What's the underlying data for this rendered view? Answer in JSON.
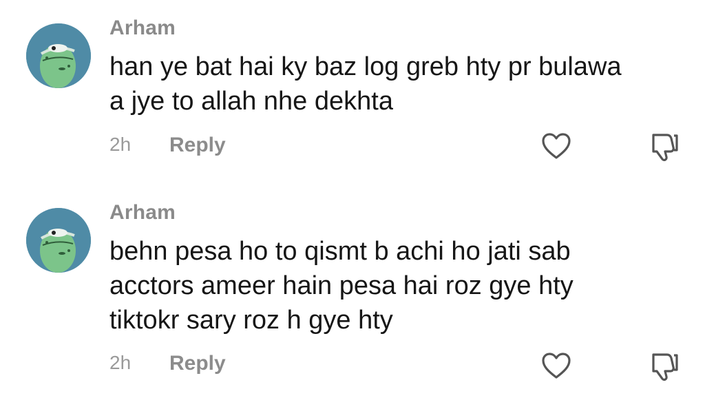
{
  "colors": {
    "avatar_bg": "#4f8ba6",
    "avatar_face": "#7cc48a",
    "username": "#8a8a8a",
    "text": "#161616",
    "meta": "#9a9a9a"
  },
  "comments": [
    {
      "username": "Arham",
      "text": "han ye bat hai ky baz log greb hty pr bulawa\na jye to allah nhe dekhta",
      "time": "2h",
      "reply_label": "Reply",
      "like_icon": "heart-outline",
      "dislike_icon": "thumbs-down-outline"
    },
    {
      "username": "Arham",
      "text": "behn pesa ho to qismt b achi ho jati sab\nacctors ameer hain pesa hai roz gye hty\ntiktokr sary roz h gye hty",
      "time": "2h",
      "reply_label": "Reply",
      "like_icon": "heart-outline",
      "dislike_icon": "thumbs-down-outline"
    }
  ]
}
